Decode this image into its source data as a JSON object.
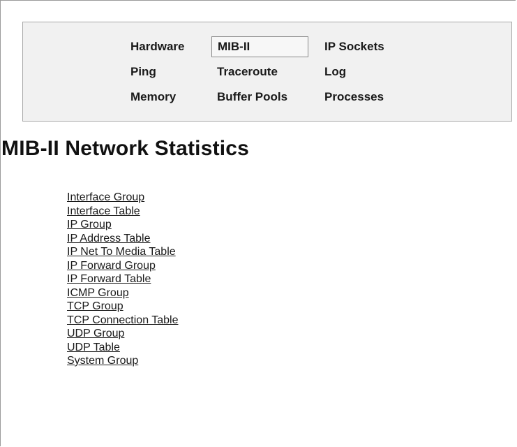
{
  "nav": {
    "items": [
      {
        "label": "Hardware",
        "active": false
      },
      {
        "label": "MIB-II",
        "active": true
      },
      {
        "label": "IP Sockets",
        "active": false
      },
      {
        "label": "Ping",
        "active": false
      },
      {
        "label": "Traceroute",
        "active": false
      },
      {
        "label": "Log",
        "active": false
      },
      {
        "label": "Memory",
        "active": false
      },
      {
        "label": "Buffer Pools",
        "active": false
      },
      {
        "label": "Processes",
        "active": false
      }
    ]
  },
  "page": {
    "title": "MIB-II Network Statistics"
  },
  "links": [
    "Interface Group",
    "Interface Table",
    "IP Group",
    "IP Address Table",
    "IP Net To Media Table",
    "IP Forward Group",
    "IP Forward Table",
    "ICMP Group",
    "TCP Group",
    "TCP Connection Table",
    "UDP Group",
    "UDP Table",
    "System Group"
  ]
}
